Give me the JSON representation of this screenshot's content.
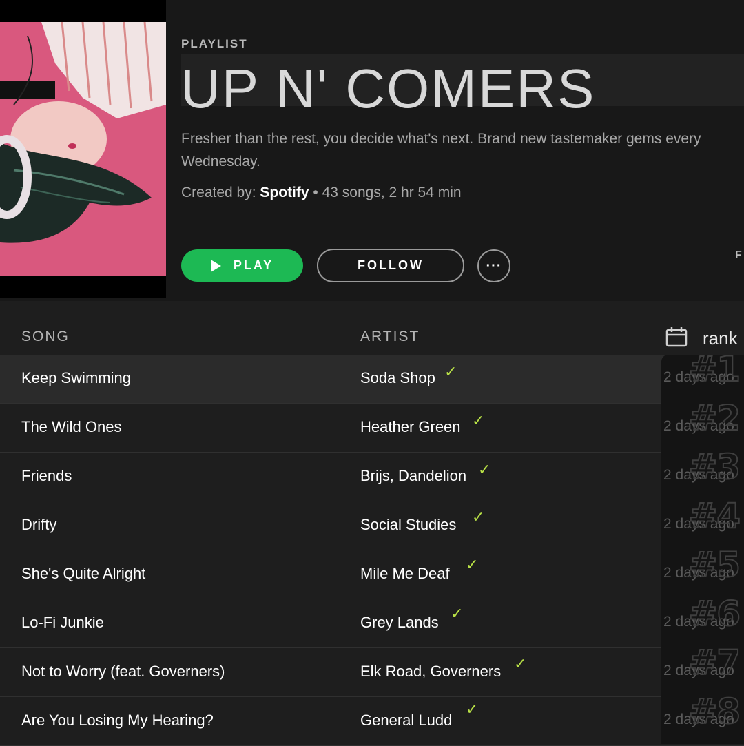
{
  "header": {
    "type_label": "PLAYLIST",
    "title": "UP N' COMERS",
    "description": "Fresher than the rest, you decide what's next. Brand new tastemaker gems every Wednesday.",
    "created_by_label": "Created by:",
    "creator": "Spotify",
    "stats": " • 43 songs, 2 hr 54 min",
    "play_label": "PLAY",
    "follow_label": "FOLLOW",
    "more_label": "···",
    "edge_text": "F"
  },
  "table": {
    "song_header": "SONG",
    "artist_header": "ARTIST",
    "rank_header": "rank",
    "rows": [
      {
        "song": "Keep Swimming",
        "artist": "Soda Shop",
        "rank": "#1",
        "added": "2 days ago"
      },
      {
        "song": "The Wild Ones",
        "artist": "Heather Green",
        "rank": "#2",
        "added": "2 days ago"
      },
      {
        "song": "Friends",
        "artist": "Brijs, Dandelion",
        "rank": "#3",
        "added": "2 days ago"
      },
      {
        "song": "Drifty",
        "artist": "Social Studies",
        "rank": "#4",
        "added": "2 days ago"
      },
      {
        "song": "She's Quite Alright",
        "artist": "Mile Me Deaf",
        "rank": "#5",
        "added": "2 days ago"
      },
      {
        "song": "Lo-Fi Junkie",
        "artist": "Grey Lands",
        "rank": "#6",
        "added": "2 days ago"
      },
      {
        "song": "Not to Worry (feat. Governers)",
        "artist": "Elk Road, Governers",
        "rank": "#7",
        "added": "2 days ago"
      },
      {
        "song": "Are You Losing My Hearing?",
        "artist": "General Ludd",
        "rank": "#8",
        "added": "2 days ago"
      }
    ]
  },
  "check_glyph": "✓",
  "colors": {
    "accent_green": "#1db954",
    "check_green": "#b8e046",
    "background": "#1e1e1e",
    "cover_pink": "#d9587e"
  },
  "icons": [
    "play-icon",
    "more-icon",
    "calendar-icon",
    "check-icon"
  ]
}
